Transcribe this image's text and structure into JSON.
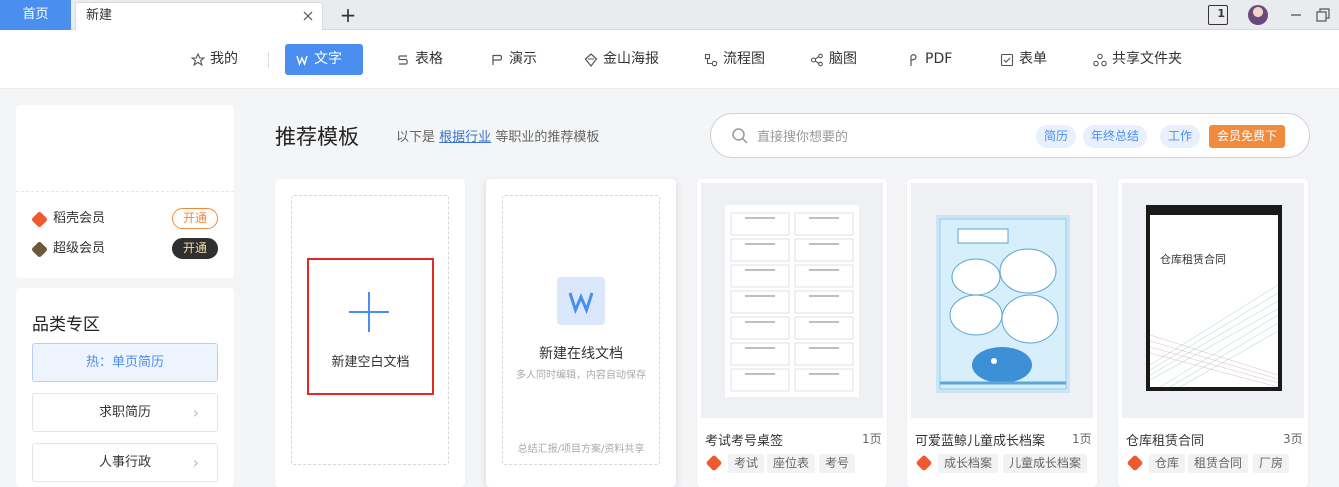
{
  "titlebar": {
    "home_tab": "首页",
    "new_tab": "新建",
    "page_badge": "1"
  },
  "nav": {
    "items": [
      {
        "label": "我的",
        "icon": "star-icon"
      },
      {
        "label": "文字",
        "icon": "w-doc-icon"
      },
      {
        "label": "表格",
        "icon": "sheet-icon"
      },
      {
        "label": "演示",
        "icon": "presentation-icon"
      },
      {
        "label": "金山海报",
        "icon": "poster-icon"
      },
      {
        "label": "流程图",
        "icon": "flowchart-icon"
      },
      {
        "label": "脑图",
        "icon": "mindmap-icon"
      },
      {
        "label": "PDF",
        "icon": "pdf-icon"
      },
      {
        "label": "表单",
        "icon": "form-icon"
      },
      {
        "label": "共享文件夹",
        "icon": "share-folder-icon"
      }
    ],
    "active": "文字"
  },
  "sidebar": {
    "vip": [
      {
        "label": "稻壳会员",
        "button": "开通",
        "color": "#ee5a2e"
      },
      {
        "label": "超级会员",
        "button": "开通",
        "color": "#6b5a3a"
      }
    ],
    "category_title": "品类专区",
    "categories": [
      {
        "label": "热：单页简历"
      },
      {
        "label": "求职简历"
      },
      {
        "label": "人事行政"
      }
    ]
  },
  "main": {
    "title": "推荐模板",
    "subtitle_prefix": "以下是",
    "subtitle_link": "根据行业",
    "subtitle_suffix": "等职业的推荐模板",
    "search_placeholder": "直接搜你想要的",
    "search_tags": [
      "简历",
      "年终总结",
      "工作"
    ],
    "vip_tag": "会员免费下"
  },
  "cards": {
    "blank": {
      "label": "新建空白文档"
    },
    "online": {
      "title": "新建在线文档",
      "subtitle": "多人同时编辑，内容自动保存",
      "footer": "总结汇报/项目方案/资料共享"
    },
    "templates": [
      {
        "name": "考试考号桌签",
        "pages": "1页",
        "tags": [
          "考试",
          "座位表",
          "考号"
        ]
      },
      {
        "name": "可爱蓝鲸儿童成长档案",
        "pages": "1页",
        "tags": [
          "成长档案",
          "儿童成长档案"
        ]
      },
      {
        "name": "仓库租赁合同",
        "pages": "3页",
        "tags": [
          "仓库",
          "租赁合同",
          "厂房"
        ],
        "cover_title": "仓库租赁合同"
      }
    ]
  },
  "colors": {
    "accent": "#4a8ef0",
    "highlight_box": "#e02b20",
    "vip_orange": "#f08a3c"
  }
}
